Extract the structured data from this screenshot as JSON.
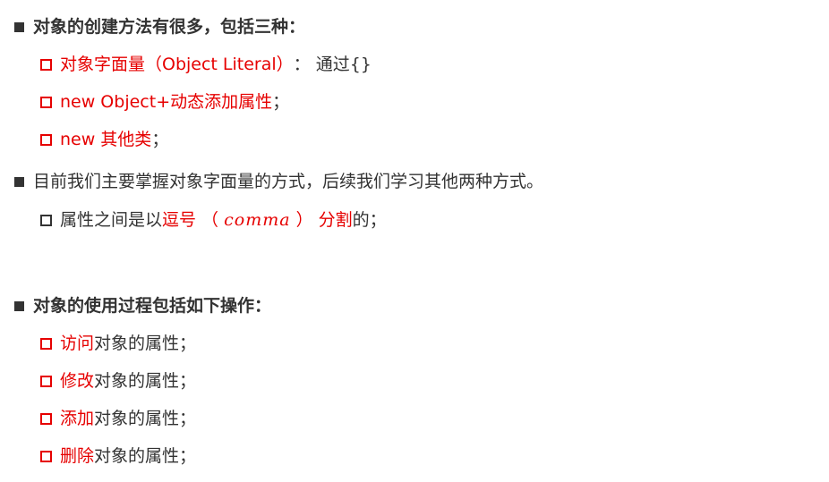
{
  "section1": {
    "heading": "对象的创建方法有很多，包括三种：",
    "items": [
      {
        "red": "对象字面量（Object Literal）",
        "rest": "：  通过{}"
      },
      {
        "red": "new Object+动态添加属性",
        "rest": "；"
      },
      {
        "red": "new 其他类",
        "rest": "；"
      }
    ]
  },
  "section2": {
    "text": "目前我们主要掌握对象字面量的方式，后续我们学习其他两种方式。",
    "sub": {
      "pre": "属性之间是以",
      "red1": "逗号 （ ",
      "script": "comma",
      "red2": " ） 分割",
      "post": "的；"
    }
  },
  "section3": {
    "heading": "对象的使用过程包括如下操作：",
    "items": [
      {
        "red": "访问",
        "rest": "对象的属性；"
      },
      {
        "red": "修改",
        "rest": "对象的属性；"
      },
      {
        "red": "添加",
        "rest": "对象的属性；"
      },
      {
        "red": "删除",
        "rest": "对象的属性；"
      }
    ]
  },
  "colors": {
    "accent": "#e60000",
    "text": "#333333"
  }
}
